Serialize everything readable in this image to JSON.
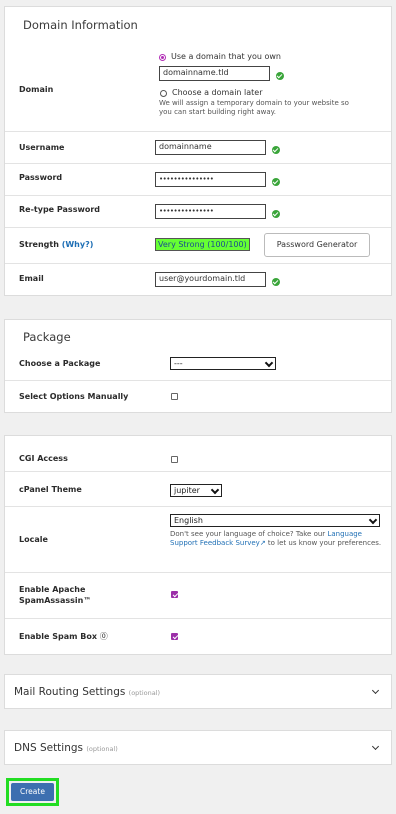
{
  "domain_info": {
    "title": "Domain Information",
    "domain_label": "Domain",
    "own_domain_option": "Use a domain that you own",
    "domain_value": "domainname.tld",
    "later_option": "Choose a domain later",
    "later_help": "We will assign a temporary domain to your website so you can start building right away.",
    "username_label": "Username",
    "username_value": "domainname",
    "password_label": "Password",
    "password_value": "•••••••••••••••",
    "retype_label": "Re-type Password",
    "retype_value": "•••••••••••••••",
    "strength_label": "Strength",
    "strength_why": "(Why?)",
    "strength_value": "Very Strong (100/100)",
    "password_generator": "Password Generator",
    "email_label": "Email",
    "email_value": "user@yourdomain.tld"
  },
  "package": {
    "title": "Package",
    "choose_label": "Choose a Package",
    "choose_value": "---",
    "manual_label": "Select Options Manually"
  },
  "options": {
    "cgi_label": "CGI Access",
    "theme_label": "cPanel Theme",
    "theme_value": "jupiter",
    "locale_label": "Locale",
    "locale_value": "English",
    "locale_help_1": "Don't see your language of choice? Take our",
    "locale_link": "Language Support Feedback Survey",
    "locale_help_2": "to let us know your preferences.",
    "spamassassin_label_1": "Enable Apache",
    "spamassassin_label_2": "SpamAssassin™",
    "spambox_label": "Enable Spam Box"
  },
  "mail_routing": {
    "title": "Mail Routing Settings",
    "optional": "(optional)"
  },
  "dns": {
    "title": "DNS Settings",
    "optional": "(optional)"
  },
  "create_button": "Create",
  "colors": {
    "accent": "#b22fb6",
    "check": "#3aa53a",
    "strength_bg": "#66ff33",
    "create_bg": "#3d6fb0",
    "highlight": "#22dd22"
  }
}
